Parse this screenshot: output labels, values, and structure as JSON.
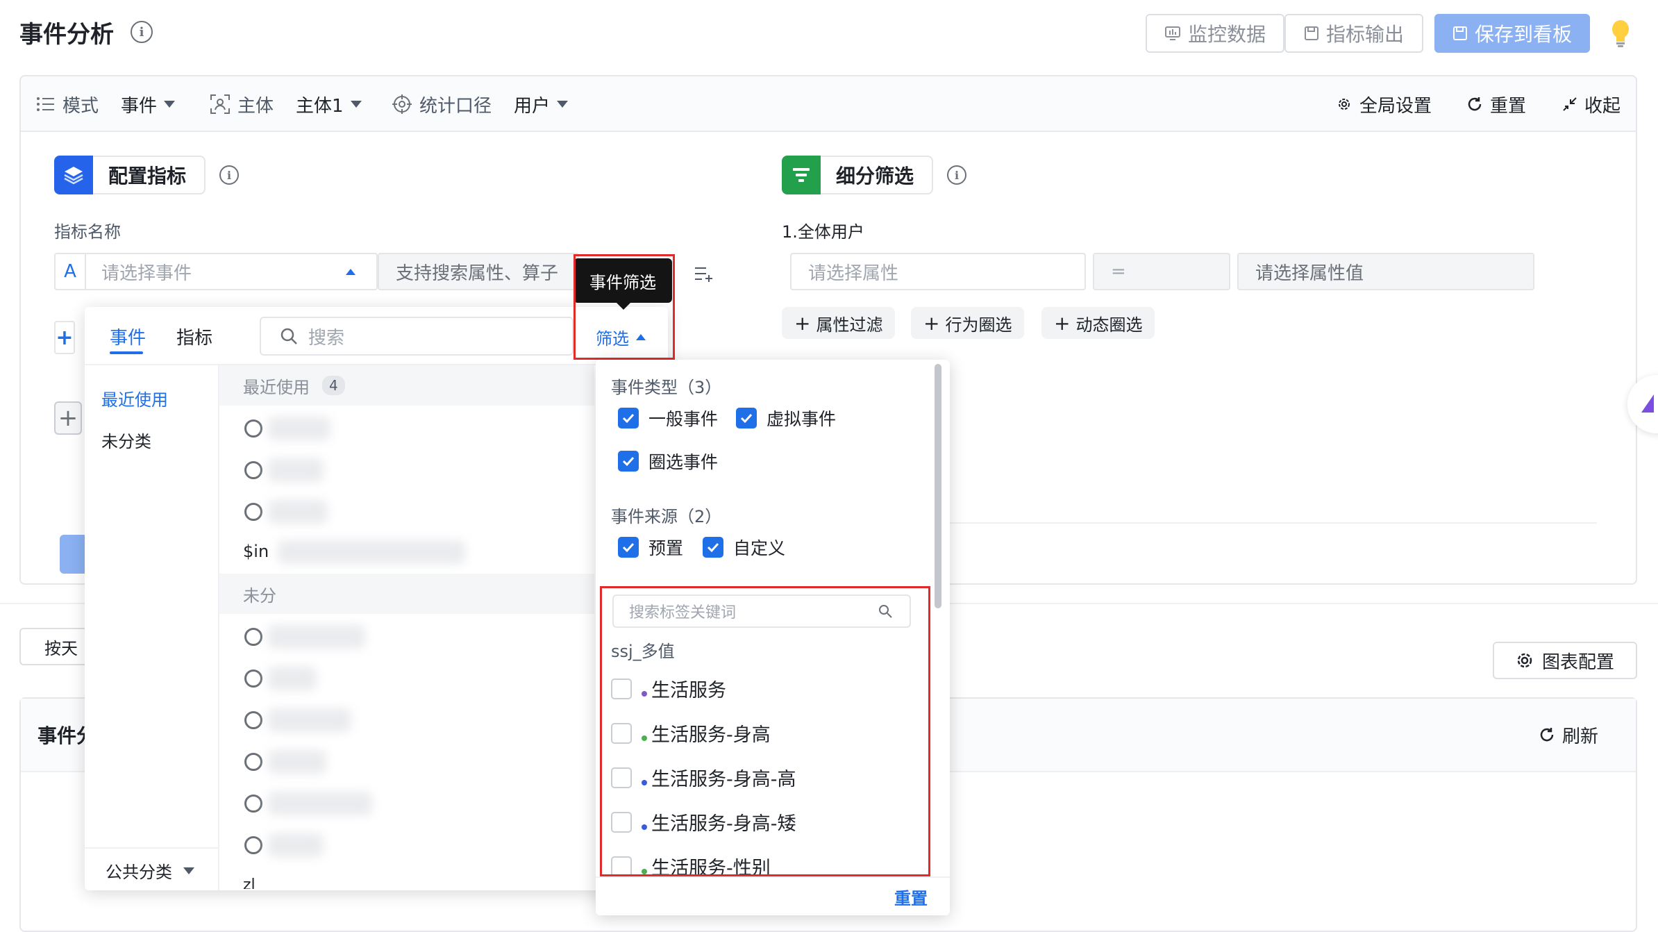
{
  "header": {
    "title": "事件分析",
    "monitor_label": "监控数据",
    "export_label": "指标输出",
    "save_label": "保存到看板"
  },
  "toolbar": {
    "mode_label": "模式",
    "mode_value": "事件",
    "subject_label": "主体",
    "subject_value": "主体1",
    "stat_label": "统计口径",
    "stat_value": "用户",
    "global_settings": "全局设置",
    "reset": "重置",
    "collapse": "收起"
  },
  "metrics": {
    "section_title": "配置指标",
    "name_label": "指标名称",
    "row_letter": "A",
    "event_placeholder": "请选择事件",
    "search_hint": "支持搜索属性、算子"
  },
  "breakdown": {
    "section_title": "细分筛选",
    "group_label": "1.全体用户",
    "attr_placeholder": "请选择属性",
    "operator": "=",
    "value_placeholder": "请选择属性值",
    "pills": [
      "属性过滤",
      "行为圈选",
      "动态圈选"
    ]
  },
  "event_picker": {
    "tabs": [
      "事件",
      "指标"
    ],
    "search_placeholder": "搜索",
    "filter_label": "筛选",
    "categories": [
      "最近使用",
      "未分类"
    ],
    "public_category": "公共分类",
    "recent_header": "最近使用",
    "recent_count": "4",
    "uncat_header": "未分",
    "partial_row": "$in",
    "partial_bottom": "zl"
  },
  "tooltip": {
    "text": "事件筛选"
  },
  "event_filter": {
    "type_title": "事件类型（3）",
    "type_options": [
      {
        "label": "一般事件",
        "checked": true
      },
      {
        "label": "虚拟事件",
        "checked": true
      },
      {
        "label": "圈选事件",
        "checked": true
      }
    ],
    "source_title": "事件来源（2）",
    "source_options": [
      {
        "label": "预置",
        "checked": true
      },
      {
        "label": "自定义",
        "checked": true
      }
    ],
    "tag_search_placeholder": "搜索标签关键词",
    "tag_group": "ssj_多值",
    "tags": [
      {
        "label": "生活服务",
        "dot_color": "#7b5cc7",
        "checked": false
      },
      {
        "label": "生活服务-身高",
        "dot_color": "#4caf50",
        "checked": false
      },
      {
        "label": "生活服务-身高-高",
        "dot_color": "#3b5bdb",
        "checked": false
      },
      {
        "label": "生活服务-身高-矮",
        "dot_color": "#3b5bdb",
        "checked": false
      },
      {
        "label": "生活服务-性别",
        "dot_color": "#4caf50",
        "checked": false
      }
    ],
    "reset_label": "重置"
  },
  "bottom": {
    "by_day": "按天",
    "chart_config": "图表配置",
    "section_title": "事件分",
    "refresh": "刷新"
  },
  "colors": {
    "primary": "#1f6fe8",
    "highlight": "#e12a2a",
    "metrics_icon": "#2563eb",
    "breakdown_icon": "#22a04b"
  }
}
